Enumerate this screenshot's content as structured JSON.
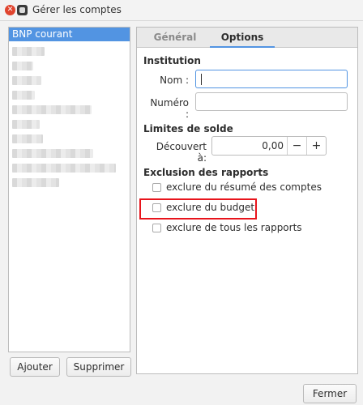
{
  "window": {
    "title": "Gérer les comptes"
  },
  "accounts": {
    "items": [
      {
        "label": "BNP courant",
        "selected": true
      }
    ]
  },
  "buttons": {
    "add": "Ajouter",
    "delete": "Supprimer",
    "close": "Fermer"
  },
  "tabs": [
    {
      "label": "Général",
      "active": false
    },
    {
      "label": "Options",
      "active": true
    }
  ],
  "institution": {
    "title": "Institution",
    "name_label": "Nom :",
    "name_value": "",
    "number_label": "Numéro :",
    "number_value": ""
  },
  "balance_limits": {
    "title": "Limites de solde",
    "overdraft_label": "Découvert à:",
    "overdraft_value": "0,00",
    "minus": "−",
    "plus": "+"
  },
  "report_exclusion": {
    "title": "Exclusion des rapports",
    "options": [
      {
        "label": "exclure du résumé des comptes",
        "checked": false
      },
      {
        "label": "exclure du budget",
        "checked": false,
        "highlighted": true
      },
      {
        "label": "exclure de tous les rapports",
        "checked": false
      }
    ]
  },
  "colors": {
    "selection": "#5294e2",
    "highlight_box": "#e8141c"
  },
  "icons": {
    "close": "close-icon",
    "app": "app-icon"
  }
}
